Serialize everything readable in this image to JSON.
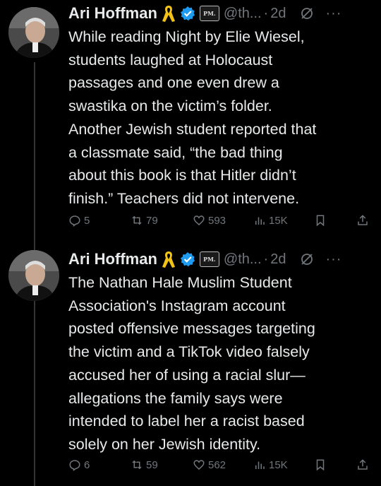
{
  "thread": [
    {
      "author": "Ari Hoffman",
      "handle": "@th...",
      "separator": "·",
      "time": "2d",
      "more": "···",
      "pm_badge": "PM.",
      "text": "While reading Night by Elie Wiesel,\nstudents laughed at Holocaust\npassages and one even drew a\nswastika on the victim’s folder.\nAnother Jewish student reported that\na classmate said, “the bad thing\nabout this book is that Hitler didn’t\nfinish.” Teachers did not intervene.",
      "replies": "5",
      "reposts": "79",
      "likes": "593",
      "views": "15K"
    },
    {
      "author": "Ari Hoffman",
      "handle": "@th...",
      "separator": "·",
      "time": "2d",
      "more": "···",
      "pm_badge": "PM.",
      "text": "The Nathan Hale Muslim Student\nAssociation's Instagram account\nposted offensive messages targeting\nthe victim and a TikTok video falsely\naccused her of using a racial slur—\nallegations the family says were\nintended to label her a racist based\nsolely on her Jewish identity.",
      "replies": "6",
      "reposts": "59",
      "likes": "562",
      "views": "15K"
    }
  ],
  "colors": {
    "background": "#000000",
    "text": "#e7e9ea",
    "muted": "#71767b",
    "verified": "#1d9bf0",
    "ribbon": "#f2c316"
  }
}
